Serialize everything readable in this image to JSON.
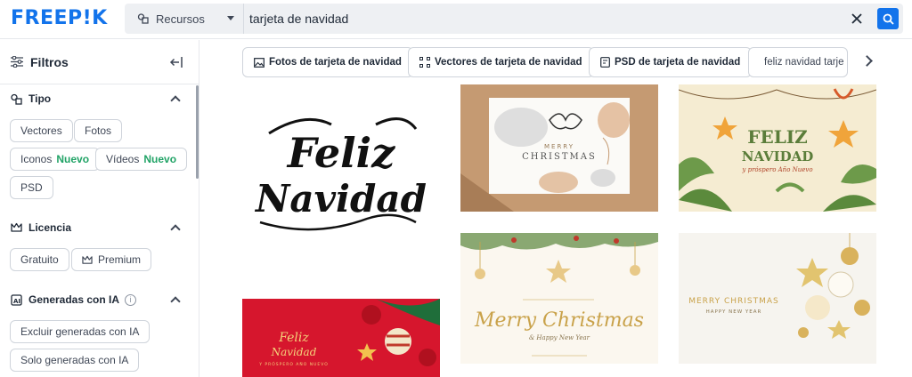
{
  "header": {
    "logo": "FREEP!K",
    "resource_select": "Recursos",
    "search_value": "tarjeta de navidad"
  },
  "sidebar": {
    "title": "Filtros",
    "sections": {
      "tipo": {
        "title": "Tipo",
        "chips": {
          "vectores": "Vectores",
          "fotos": "Fotos",
          "iconos": "Iconos",
          "videos": "Vídeos",
          "psd": "PSD",
          "new_badge": "Nuevo"
        }
      },
      "licencia": {
        "title": "Licencia",
        "chips": {
          "gratuito": "Gratuito",
          "premium": "Premium"
        }
      },
      "ia": {
        "title": "Generadas con IA",
        "info": "i",
        "chips": {
          "excluir": "Excluir generadas con IA",
          "solo": "Solo generadas con IA"
        }
      }
    }
  },
  "suggestions": {
    "fotos": "Fotos de tarjeta de navidad",
    "vectores": "Vectores de tarjeta de navidad",
    "psd": "PSD de tarjeta de navidad",
    "search": "feliz navidad tarje"
  },
  "tiles": {
    "feliz_script_line1": "Feliz",
    "feliz_script_line2": "Navidad",
    "merry_small": "MERRY",
    "christmas_small": "CHRISTMAS",
    "feliz_big": "FELIZ",
    "navidad_big": "NAVIDAD",
    "prospero": "y próspero Año Nuevo",
    "merry_script": "Merry Christmas",
    "happy_ny": "& Happy New Year",
    "merry_gold": "MERRY CHRISTMAS",
    "happy_gold": "HAPPY NEW YEAR",
    "red_feliz": "Feliz",
    "red_navidad": "Navidad",
    "red_sub": "Y PRÓSPERO AÑO NUEVO"
  },
  "colors": {
    "brand": "#1273eb",
    "new_badge": "#21a366",
    "gold": "#c9a24a",
    "red": "#d6162d"
  }
}
